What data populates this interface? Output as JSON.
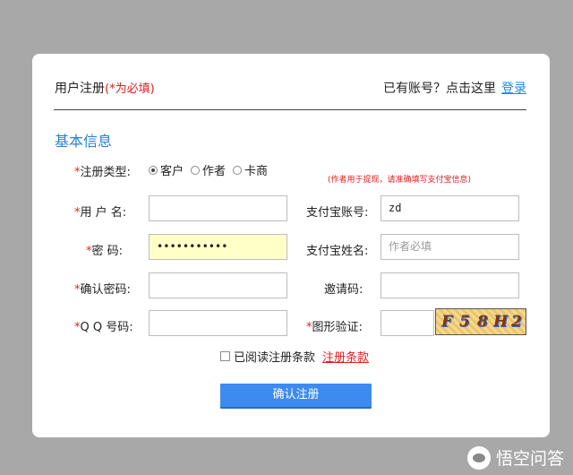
{
  "header": {
    "title": "用户注册",
    "required_hint": "(*为必填)",
    "login_prompt": "已有账号？点击这里",
    "login_link": "登录"
  },
  "section": {
    "title": "基本信息"
  },
  "form": {
    "star": "*",
    "reg_type_label": "注册类型:",
    "reg_type_options": [
      {
        "label": "客户",
        "selected": true
      },
      {
        "label": "作者",
        "selected": false
      },
      {
        "label": "卡商",
        "selected": false
      }
    ],
    "author_note": "(作者用于提现，请准确填写支付宝信息)",
    "username_label": "用 户 名:",
    "password_label": "密    码:",
    "password_value": "•••••••••••",
    "confirm_label": "确认密码:",
    "qq_label": "Q Q 号码:",
    "alipay_account_label": "支付宝账号:",
    "alipay_account_value": "zd",
    "alipay_name_label": "支付宝姓名:",
    "alipay_name_placeholder": "作者必填",
    "invite_label": "邀请码:",
    "captcha_label": "图形验证:",
    "captcha_text": [
      "F",
      "5",
      "8",
      "H",
      "2"
    ]
  },
  "agree": {
    "text": "已阅读注册条款",
    "link": "注册条款"
  },
  "submit_label": "确认注册",
  "watermark": "悟空问答",
  "colors": {
    "accent": "#2b7fd0",
    "required": "#e02020",
    "button": "#3d8af0",
    "password_bg": "#ffffc8"
  }
}
